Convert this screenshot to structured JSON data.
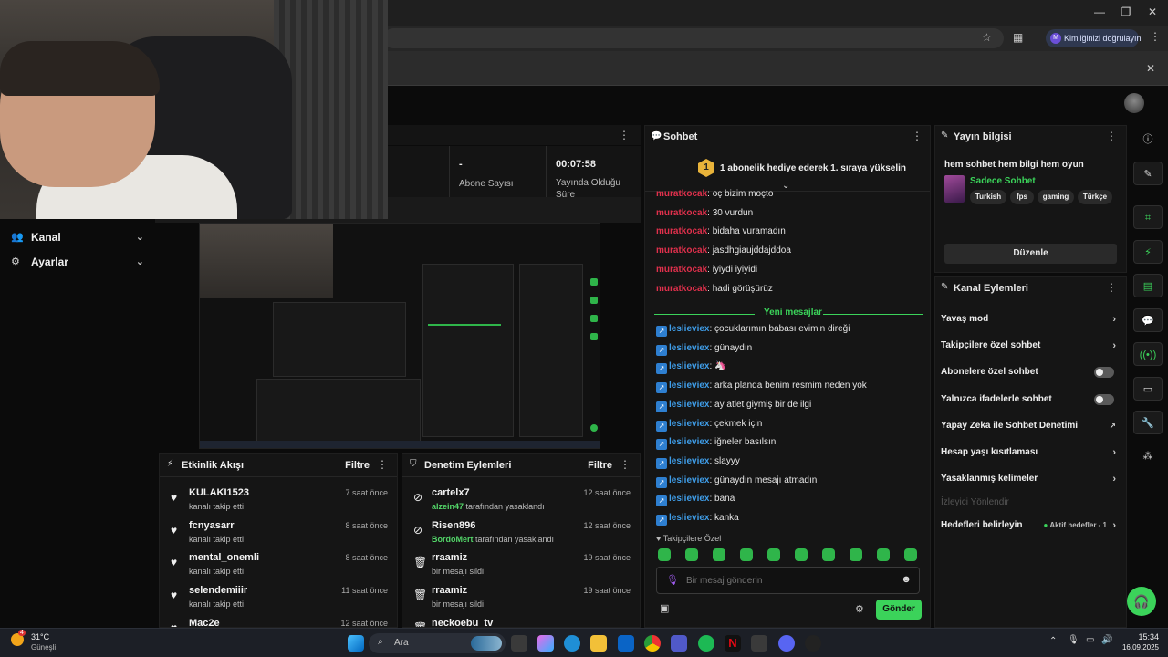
{
  "browser": {
    "verify_label": "Kimliğinizi doğrulayın",
    "verify_avatar": "M",
    "window_controls": [
      "—",
      "❐",
      "✕"
    ]
  },
  "stats": [
    {
      "value": "",
      "label": ""
    },
    {
      "value": "-",
      "label": "Abone Sayısı"
    },
    {
      "value": "00:07:58",
      "label": "Yayında Olduğu Süre"
    }
  ],
  "sidebar": {
    "items": [
      {
        "label": "Kanal",
        "icon": "users-icon"
      },
      {
        "label": "Ayarlar",
        "icon": "gear-icon"
      }
    ]
  },
  "activity": {
    "title": "Etkinlik Akışı",
    "filter": "Filtre",
    "rows": [
      {
        "name": "KULAKI1523",
        "sub": "kanalı takip etti",
        "time": "7 saat önce"
      },
      {
        "name": "fcnyasarr",
        "sub": "kanalı takip etti",
        "time": "8 saat önce"
      },
      {
        "name": "mental_onemli",
        "sub": "kanalı takip etti",
        "time": "8 saat önce"
      },
      {
        "name": "selendemiiir",
        "sub": "kanalı takip etti",
        "time": "11 saat önce"
      },
      {
        "name": "Mac2e",
        "sub": "",
        "time": "12 saat önce"
      }
    ]
  },
  "moderation": {
    "title": "Denetim Eylemleri",
    "filter": "Filtre",
    "rows": [
      {
        "name": "cartelx7",
        "by": "alzein47",
        "sub": " tarafından yasaklandı",
        "time": "12 saat önce",
        "icon": "ban-icon"
      },
      {
        "name": "Risen896",
        "by": "BordoMert",
        "sub": " tarafından yasaklandı",
        "time": "12 saat önce",
        "icon": "ban-icon"
      },
      {
        "name": "rraamiz",
        "by": "",
        "sub": "bir mesajı sildi",
        "time": "19 saat önce",
        "icon": "trash-icon"
      },
      {
        "name": "rraamiz",
        "by": "",
        "sub": "bir mesajı sildi",
        "time": "19 saat önce",
        "icon": "trash-icon"
      },
      {
        "name": "neckoebu_tv",
        "by": "",
        "sub": "",
        "time": "",
        "icon": "trash-icon"
      }
    ]
  },
  "chat": {
    "title": "Sohbet",
    "pinned_badge": "1",
    "pinned": "1 abonelik hediye ederek 1. sıraya yükselin",
    "old_messages": [
      {
        "user": "muratkocak",
        "text": ": oç bizim moçto"
      },
      {
        "user": "muratkocak",
        "text": ": 30 vurdun"
      },
      {
        "user": "muratkocak",
        "text": ": bidaha vuramadın"
      },
      {
        "user": "muratkocak",
        "text": ": jasdhgiaujddajddoa"
      },
      {
        "user": "muratkocak",
        "text": ": iyiydi iyiyidi"
      },
      {
        "user": "muratkocak",
        "text": ": hadi görüşürüz"
      }
    ],
    "new_label": "Yeni mesajlar",
    "new_messages": [
      {
        "user": "leslieviex",
        "text": ": çocuklarımın babası evimin direği"
      },
      {
        "user": "leslieviex",
        "text": ": günaydın"
      },
      {
        "user": "leslieviex",
        "text": ": 🦄"
      },
      {
        "user": "leslieviex",
        "text": ": arka planda benim resmim neden yok"
      },
      {
        "user": "leslieviex",
        "text": ": ay atlet giymiş bir de ilgi"
      },
      {
        "user": "leslieviex",
        "text": ": çekmek için"
      },
      {
        "user": "leslieviex",
        "text": ": iğneler basılsın"
      },
      {
        "user": "leslieviex",
        "text": ": slayyy"
      },
      {
        "user": "leslieviex",
        "text": ": günaydın mesajı atmadın"
      },
      {
        "user": "leslieviex",
        "text": ": bana"
      },
      {
        "user": "leslieviex",
        "text": ": kanka"
      }
    ],
    "followers_only": "Takipçilere Özel",
    "input_placeholder": "Bir mesaj gönderin",
    "send_label": "Gönder"
  },
  "stream_info": {
    "title": "Yayın bilgisi",
    "stream_title": "hem sohbet hem bilgi hem oyun",
    "category": "Sadece Sohbet",
    "tags": [
      "Turkish",
      "fps",
      "gaming",
      "Türkçe"
    ],
    "edit_label": "Düzenle"
  },
  "channel_actions": {
    "title": "Kanal Eylemleri",
    "items": [
      {
        "label": "Yavaş mod",
        "control": "chevron"
      },
      {
        "label": "Takipçilere özel sohbet",
        "control": "chevron"
      },
      {
        "label": "Abonelere özel sohbet",
        "control": "toggle"
      },
      {
        "label": "Yalnızca ifadelerle sohbet",
        "control": "toggle"
      },
      {
        "label": "Yapay Zeka ile Sohbet Denetimi",
        "control": "external"
      },
      {
        "label": "Hesap yaşı kısıtlaması",
        "control": "chevron"
      },
      {
        "label": "Yasaklanmış kelimeler",
        "control": "chevron"
      }
    ],
    "section_label": "İzleyici Yönlendir",
    "goals_label": "Hedefleri belirleyin",
    "goals_status": "Aktif hedefler - 1"
  },
  "taskbar": {
    "weather_temp": "31°C",
    "weather_desc": "Güneşli",
    "weather_badge": "4",
    "search_label": "Ara",
    "time": "15:34",
    "date": "16.09.2025"
  },
  "colors": {
    "accent": "#3bd35a",
    "old_user": "#e0304c",
    "new_user": "#3f9de8"
  }
}
